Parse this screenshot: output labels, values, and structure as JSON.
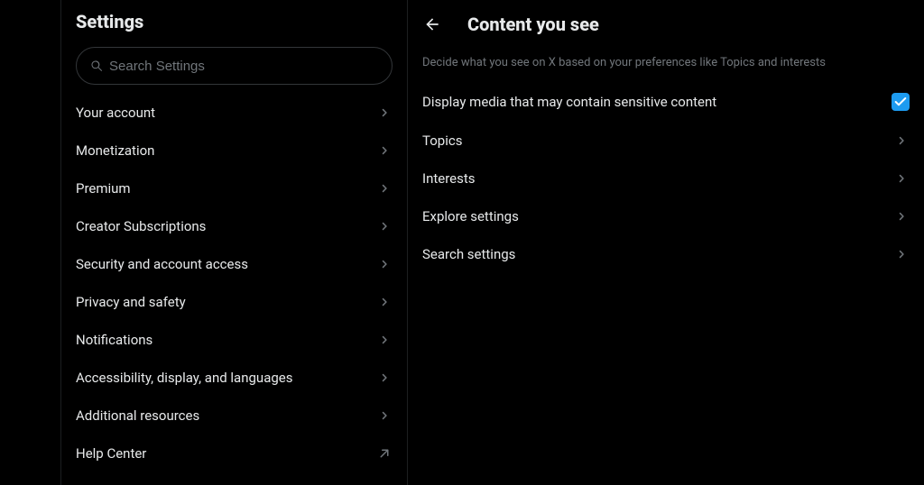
{
  "sidebar": {
    "title": "Settings",
    "search_placeholder": "Search Settings",
    "items": [
      {
        "label": "Your account",
        "external": false
      },
      {
        "label": "Monetization",
        "external": false
      },
      {
        "label": "Premium",
        "external": false
      },
      {
        "label": "Creator Subscriptions",
        "external": false
      },
      {
        "label": "Security and account access",
        "external": false
      },
      {
        "label": "Privacy and safety",
        "external": false
      },
      {
        "label": "Notifications",
        "external": false
      },
      {
        "label": "Accessibility, display, and languages",
        "external": false
      },
      {
        "label": "Additional resources",
        "external": false
      },
      {
        "label": "Help Center",
        "external": true
      }
    ]
  },
  "main": {
    "title": "Content you see",
    "description": "Decide what you see on X based on your preferences like Topics and interests",
    "sensitive_label": "Display media that may contain sensitive content",
    "sensitive_checked": true,
    "links": [
      {
        "label": "Topics"
      },
      {
        "label": "Interests"
      },
      {
        "label": "Explore settings"
      },
      {
        "label": "Search settings"
      }
    ]
  }
}
